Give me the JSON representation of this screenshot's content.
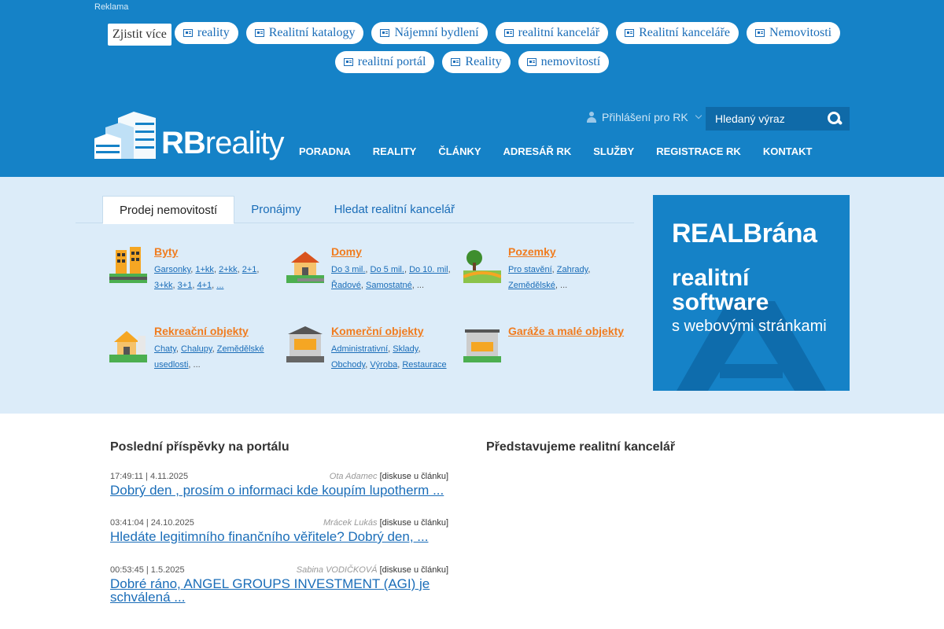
{
  "ad": {
    "label": "Reklama",
    "more": "Zjistit více",
    "row1": [
      "reality",
      "Realitní katalogy",
      "Nájemní bydlení",
      "realitní kancelář",
      "Realitní kanceláře",
      "Nemovitosti"
    ],
    "row2": [
      "realitní portál",
      "Reality",
      "nemovitostí"
    ]
  },
  "logo": {
    "bold": "RB",
    "rest": "reality"
  },
  "login": {
    "label": "Přihlášení pro RK"
  },
  "search": {
    "placeholder": "Hledaný výraz"
  },
  "nav": [
    "PORADNA",
    "REALITY",
    "ČLÁNKY",
    "ADRESÁŘ RK",
    "SLUŽBY",
    "REGISTRACE RK",
    "KONTAKT"
  ],
  "tabs": [
    "Prodej nemovitostí",
    "Pronájmy",
    "Hledat realitní kancelář"
  ],
  "categories": [
    {
      "title": "Byty",
      "links": [
        "Garsonky",
        "1+kk",
        "2+kk",
        "2+1",
        "3+kk",
        "3+1",
        "4+1",
        "..."
      ],
      "tail": ""
    },
    {
      "title": "Domy",
      "links": [
        "Do 3 mil.",
        "Do 5 mil.",
        "Do 10. mil",
        "Řadové",
        "Samostatné"
      ],
      "tail": ", ..."
    },
    {
      "title": "Pozemky",
      "links": [
        "Pro stavění",
        "Zahrady",
        "Zemědělské"
      ],
      "tail": ", ..."
    },
    {
      "title": "Rekreační objekty",
      "links": [
        "Chaty",
        "Chalupy",
        "Zemědělské usedlosti"
      ],
      "tail": ", ..."
    },
    {
      "title": "Komerční objekty",
      "links": [
        "Administrativní",
        "Sklady",
        "Obchody",
        "Výroba",
        "Restaurace"
      ],
      "tail": ""
    },
    {
      "title": "Garáže a malé objekty",
      "links": [],
      "tail": ""
    }
  ],
  "banner": {
    "title": "REALBrána",
    "sub1": "realitní software",
    "sub2": "s webovými stránkami",
    "big_letter": "A"
  },
  "posts_heading": "Poslední příspěvky na portálu",
  "agency_heading": "Představujeme realitní kancelář",
  "posts": [
    {
      "date": "17:49:11 | 4.11.2025",
      "author": "Ota Adamec",
      "discussion": "[diskuse u článku]",
      "title": "Dobrý den , prosím o informaci kde koupím lupotherm ..."
    },
    {
      "date": "03:41:04 | 24.10.2025",
      "author": "Mrácek Lukás",
      "discussion": "[diskuse u článku]",
      "title": "Hledáte legitimního finančního věřitele? Dobrý den, ..."
    },
    {
      "date": "00:53:45 | 1.5.2025",
      "author": "Sabina VODIČKOVÁ",
      "discussion": "[diskuse u článku]",
      "title": "Dobré ráno, ANGEL GROUPS INVESTMENT (AGI) je schválená ..."
    }
  ],
  "colors": {
    "header": "#1582c7",
    "band": "#dcecf9",
    "accent_orange": "#f07c1f",
    "link_blue": "#1a6db8"
  }
}
